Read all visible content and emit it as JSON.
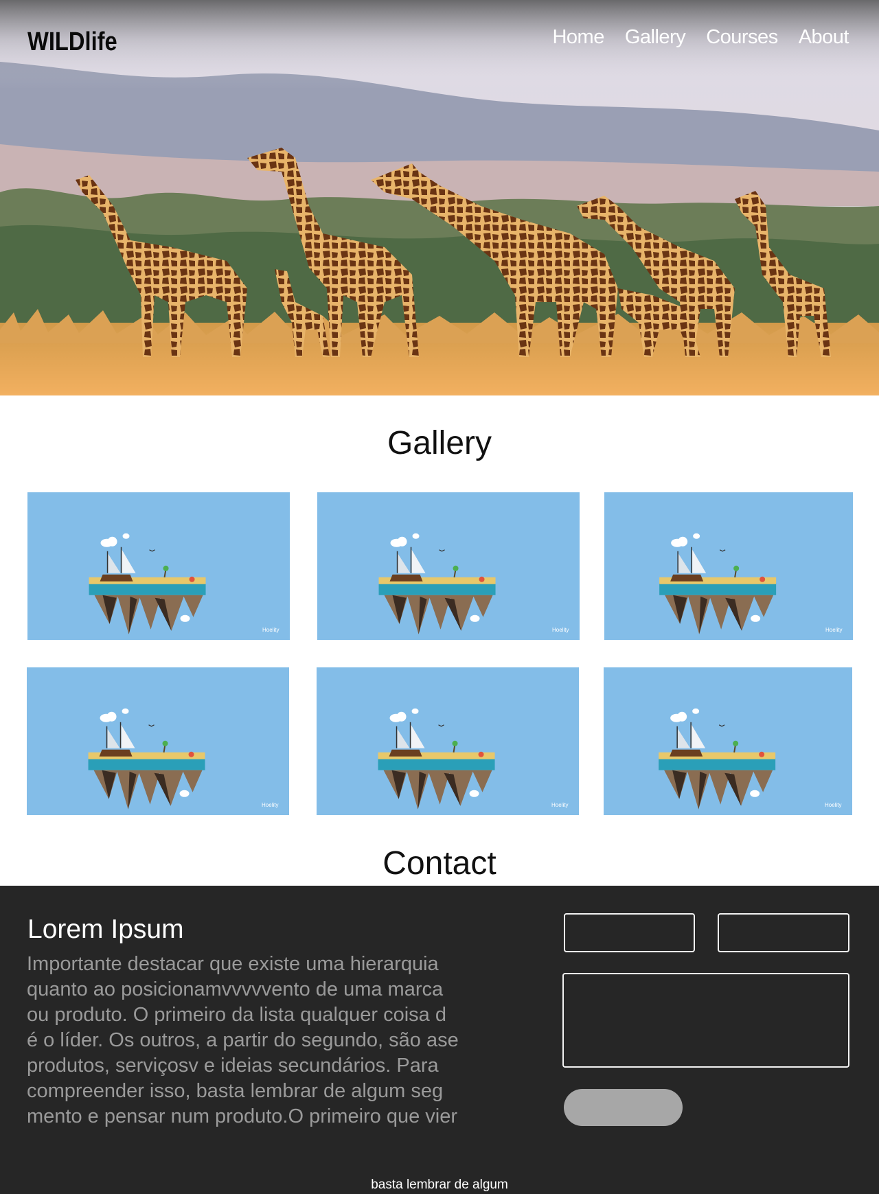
{
  "header": {
    "logo": "WILDlife",
    "nav": [
      "Home",
      "Gallery",
      "Courses",
      "About"
    ]
  },
  "gallery": {
    "title": "Gallery",
    "image_count": 6,
    "image_subject": "floating island with sailing ship",
    "watermark": "Hoelity"
  },
  "contact": {
    "title": "Contact",
    "heading": "Lorem Ipsum",
    "body": "Importante destacar que existe uma hierarquia\nquanto ao posicionamvvvvvento  de uma marca\nou produto. O primeiro da lista qualquer coisa d\né o líder. Os outros, a partir do segundo, são ase\nprodutos, serviçosv e ideias secundários. Para\ncompreender isso, basta lembrar de algum seg\nmento e pensar num produto.O primeiro que vier",
    "footer_note": "basta lembrar de algum"
  },
  "colors": {
    "tile_bg": "#83bde8",
    "contact_bg": "#262626",
    "button_bg": "#a7a7a7"
  }
}
